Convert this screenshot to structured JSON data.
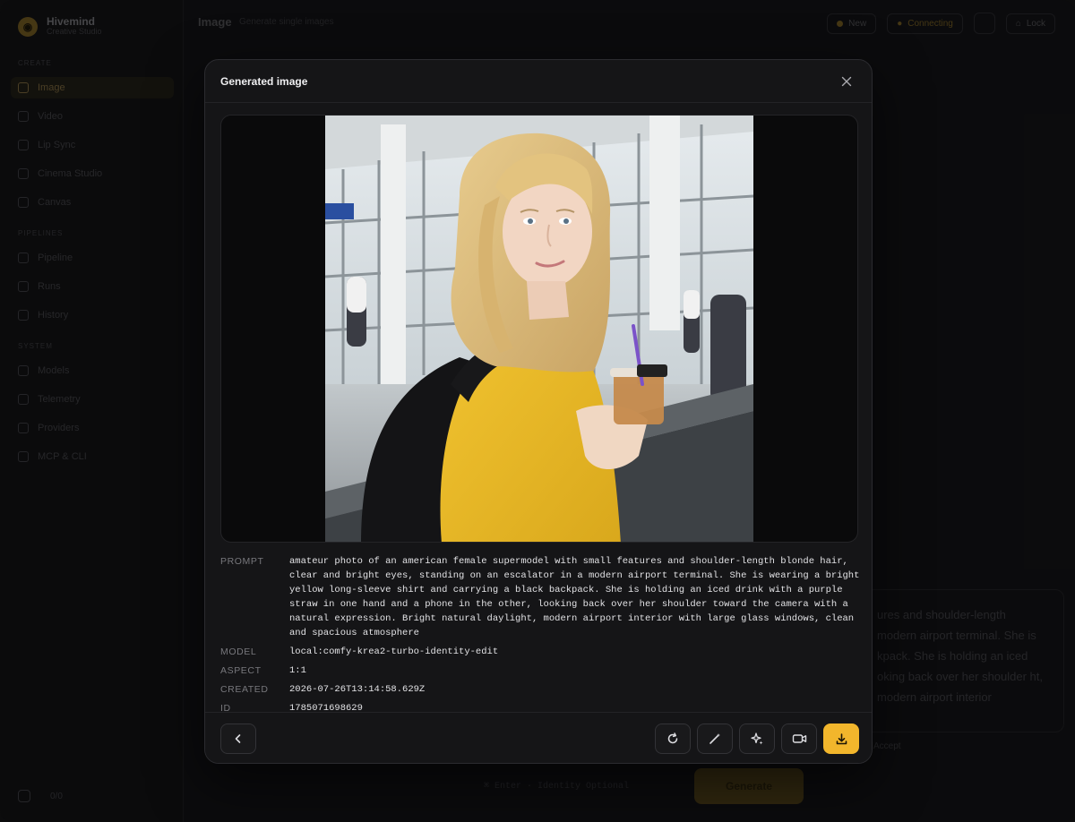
{
  "app": {
    "brand_name": "Hivemind",
    "brand_sub": "Creative Studio"
  },
  "sidebar": {
    "section_create": "CREATE",
    "section_pipelines": "PIPELINES",
    "section_system": "SYSTEM",
    "items": [
      {
        "label": "Image",
        "icon": "image-icon",
        "active": true
      },
      {
        "label": "Video",
        "icon": "video-icon"
      },
      {
        "label": "Lip Sync",
        "icon": "lip-sync-icon"
      },
      {
        "label": "Cinema Studio",
        "icon": "cinema-icon"
      },
      {
        "label": "Canvas",
        "icon": "canvas-icon"
      },
      {
        "label": "Pipeline",
        "icon": "pipeline-icon"
      },
      {
        "label": "Runs",
        "icon": "runs-icon"
      },
      {
        "label": "History",
        "icon": "history-icon"
      },
      {
        "label": "Models",
        "icon": "models-icon"
      },
      {
        "label": "Telemetry",
        "icon": "telemetry-icon"
      },
      {
        "label": "Providers",
        "icon": "providers-icon"
      },
      {
        "label": "MCP & CLI",
        "icon": "terminal-icon"
      }
    ],
    "footer_label": "0/0"
  },
  "topbar": {
    "title": "Image",
    "subtitle": "Generate single images",
    "pill_1": "New",
    "pill_2": "Connecting",
    "pill_3": "Lock"
  },
  "background": {
    "prompt_snippet": "ures and shoulder-length modern airport terminal. She is kpack. She is holding an iced oking back over her shoulder ht, modern airport interior",
    "hint": "⌘ Enter · Identity Optional",
    "accept_label": "Accept",
    "generate_label": "Generate"
  },
  "modal": {
    "title": "Generated image",
    "meta": [
      {
        "key": "PROMPT",
        "value": "amateur photo of an american female supermodel with small features and shoulder-length blonde hair, clear and bright eyes, standing on an escalator in a modern airport terminal. She is wearing a bright yellow long-sleeve shirt and carrying a black backpack. She is holding an iced drink with a purple straw in one hand and a phone in the other, looking back over her shoulder toward the camera with a natural expression. Bright natural daylight, modern airport interior with large glass windows, clean and spacious atmosphere"
      },
      {
        "key": "MODEL",
        "value": "local:comfy-krea2-turbo-identity-edit"
      },
      {
        "key": "ASPECT",
        "value": "1:1"
      },
      {
        "key": "CREATED",
        "value": "2026-07-26T13:14:58.629Z"
      },
      {
        "key": "ID",
        "value": "1785071698629"
      }
    ],
    "actions": [
      "back-icon",
      "regenerate-icon",
      "wand-icon",
      "sparkle-icon",
      "video-camera-icon",
      "download-icon"
    ]
  },
  "colors": {
    "accent": "#f2b62c",
    "modal_bg": "#151517",
    "text_muted": "#77777c"
  }
}
